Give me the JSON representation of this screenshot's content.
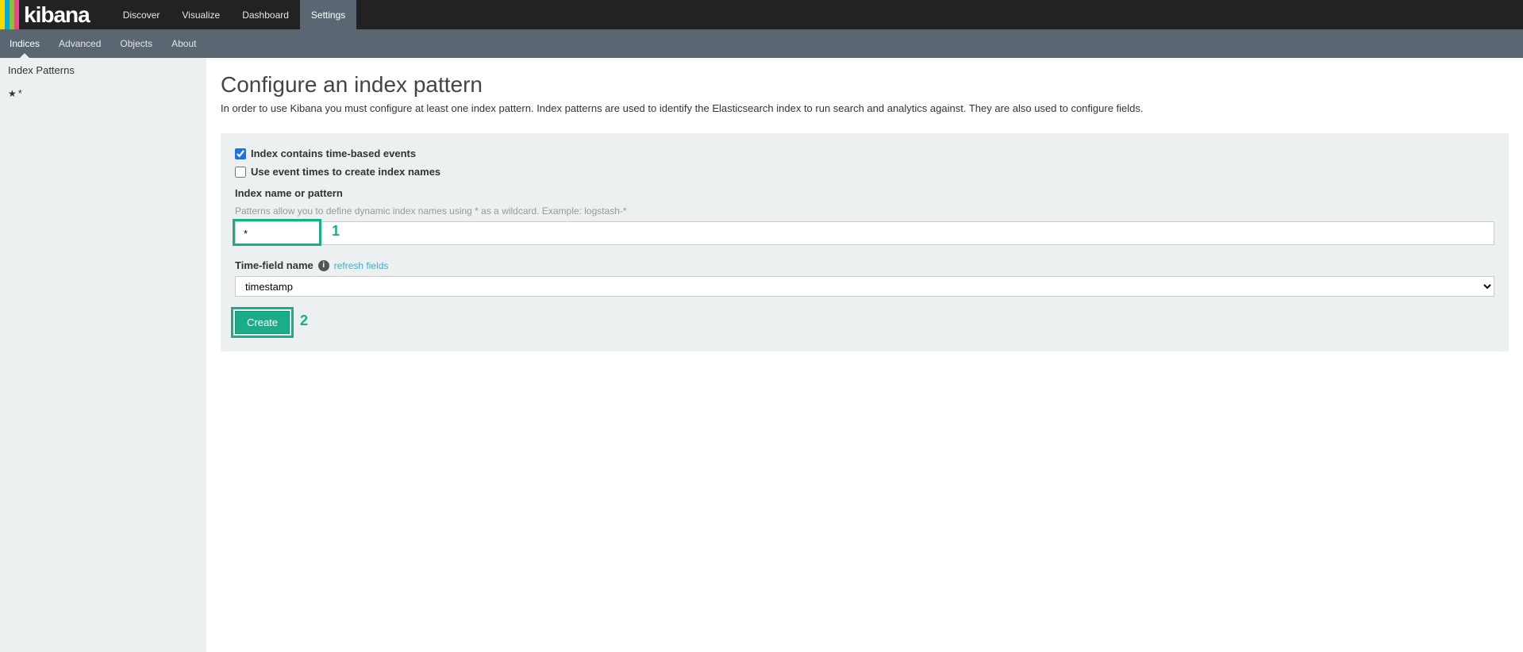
{
  "logo": {
    "text": "kibana"
  },
  "nav": {
    "tabs": [
      "Discover",
      "Visualize",
      "Dashboard",
      "Settings"
    ],
    "active": "Settings"
  },
  "subnav": {
    "tabs": [
      "Indices",
      "Advanced",
      "Objects",
      "About"
    ],
    "active": "Indices"
  },
  "sidebar": {
    "header": "Index Patterns",
    "items": [
      {
        "starred": true,
        "label": "*"
      }
    ]
  },
  "page": {
    "title": "Configure an index pattern",
    "description": "In order to use Kibana you must configure at least one index pattern. Index patterns are used to identify the Elasticsearch index to run search and analytics against. They are also used to configure fields."
  },
  "form": {
    "checkbox_time_based": {
      "label": "Index contains time-based events",
      "checked": true
    },
    "checkbox_event_times": {
      "label": "Use event times to create index names",
      "checked": false
    },
    "index_name": {
      "label": "Index name or pattern",
      "help": "Patterns allow you to define dynamic index names using * as a wildcard. Example: logstash-*",
      "value": "*"
    },
    "time_field": {
      "label": "Time-field name",
      "refresh_link": "refresh fields",
      "selected": "timestamp",
      "options": [
        "timestamp"
      ]
    },
    "create_button": "Create"
  },
  "annotations": {
    "num1": "1",
    "num2": "2"
  }
}
